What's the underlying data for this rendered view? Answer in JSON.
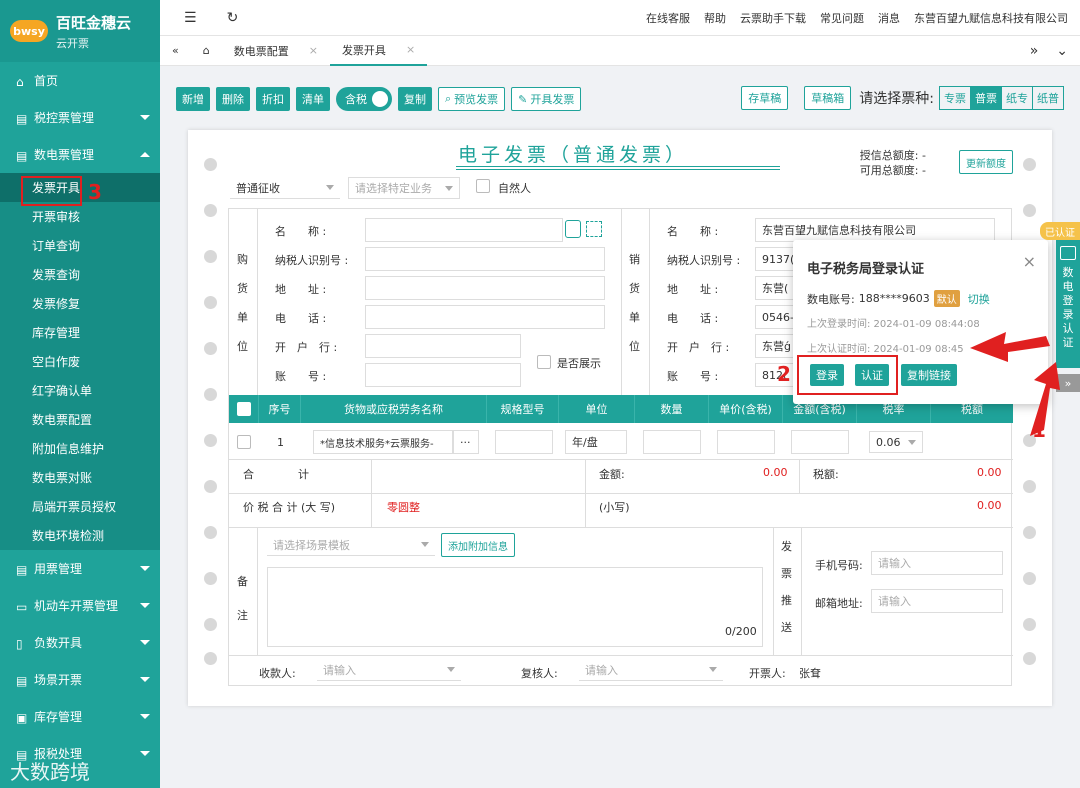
{
  "brand": {
    "logo_text": "bwsy",
    "name": "百旺金穗云",
    "sub": "云开票"
  },
  "sidebar": {
    "home": "首页",
    "tax_control": "税控票管理",
    "digital": "数电票管理",
    "sub_items": [
      "发票开具",
      "开票审核",
      "订单查询",
      "发票查询",
      "发票修复",
      "库存管理",
      "空白作废",
      "红字确认单",
      "数电票配置",
      "附加信息维护",
      "数电票对账",
      "局端开票员授权",
      "数电环境检测"
    ],
    "bottom_items": [
      "用票管理",
      "机动车开票管理",
      "负数开具",
      "场景开票",
      "库存管理",
      "报税处理"
    ]
  },
  "topbar": {
    "items": [
      "在线客服",
      "帮助",
      "云票助手下载",
      "常见问题",
      "消息",
      "东营百望九赋信息科技有限公司"
    ]
  },
  "tabs": [
    "数电票配置",
    "发票开具"
  ],
  "toolbar": {
    "add": "新增",
    "del": "删除",
    "discount": "折扣",
    "clear": "清单",
    "tax_incl": "含税",
    "copy": "复制",
    "preview": "预览发票",
    "issue": "开具发票",
    "save_draft": "存草稿",
    "draft_box": "草稿箱",
    "select_type": "请选择票种:",
    "types": [
      "专票",
      "普票",
      "纸专",
      "纸普"
    ]
  },
  "invoice": {
    "title": "电子发票（普通发票）",
    "credit_total": "授信总额度:",
    "credit_val": "-",
    "avail_total": "可用总额度:",
    "avail_val": "-",
    "refresh": "更新额度",
    "levy": "普通征收",
    "special_biz": "请选择特定业务",
    "natural_person": "自然人",
    "buyer_label": [
      "购",
      "货",
      "单",
      "位"
    ],
    "seller_label": [
      "销",
      "货",
      "单",
      "位"
    ],
    "fields": [
      "名　　称 :",
      "纳税人识别号 :",
      "地　　址 :",
      "电　　话 :",
      "开　户　行 :",
      "账　　号 :"
    ],
    "show_label": "是否展示",
    "seller_name": "东营百望九赋信息科技有限公司",
    "seller_tax": "9137(",
    "seller_addr": "东营(",
    "seller_tel": "0546-",
    "seller_bank": "东营ǵ",
    "seller_acc": "812(",
    "cols": [
      "序号",
      "货物或应税劳务名称",
      "规格型号",
      "单位",
      "数量",
      "单价(含税)",
      "金额(含税)",
      "税率",
      "税额"
    ],
    "row": {
      "no": "1",
      "name": "*信息技术服务*云票服务-",
      "unit": "年/盘",
      "rate": "0.06"
    },
    "total_label": "合　　　　计",
    "amount_label": "金额:",
    "amount_val": "0.00",
    "tax_label": "税额:",
    "tax_val": "0.00",
    "cap_label": "价 税 合 计 (大 写)",
    "cap_val": "零圆整",
    "small_label": "(小写)",
    "small_val": "0.00",
    "remark_label": [
      "备",
      "注"
    ],
    "scene_tpl": "请选择场景模板",
    "add_info": "添加附加信息",
    "counter": "0/200",
    "push_label": [
      "发",
      "票",
      "推",
      "送"
    ],
    "phone_label": "手机号码:",
    "phone_ph": "请输入",
    "email_label": "邮箱地址:",
    "email_ph": "请输入",
    "payee_label": "收款人:",
    "payee_ph": "请输入",
    "reviewer_label": "复核人:",
    "reviewer_ph": "请输入",
    "drawer_label": "开票人:",
    "drawer_val": "张耷"
  },
  "popup": {
    "title": "电子税务局登录认证",
    "account_label": "数电账号:",
    "account": "188****9603",
    "default_tag": "默认",
    "switch": "切换",
    "last_login": "上次登录时间: 2024-01-09 08:44:08",
    "last_auth": "上次认证时间: 2024-01-09 08:45",
    "login": "登录",
    "auth": "认证",
    "copy_link": "复制链接"
  },
  "side_panel": {
    "tag": "已认证",
    "text": [
      "数",
      "电",
      "登",
      "录",
      "认",
      "证"
    ]
  },
  "annotations": {
    "n1": "1",
    "n2": "2",
    "n3": "3"
  },
  "watermark": "大数跨境"
}
